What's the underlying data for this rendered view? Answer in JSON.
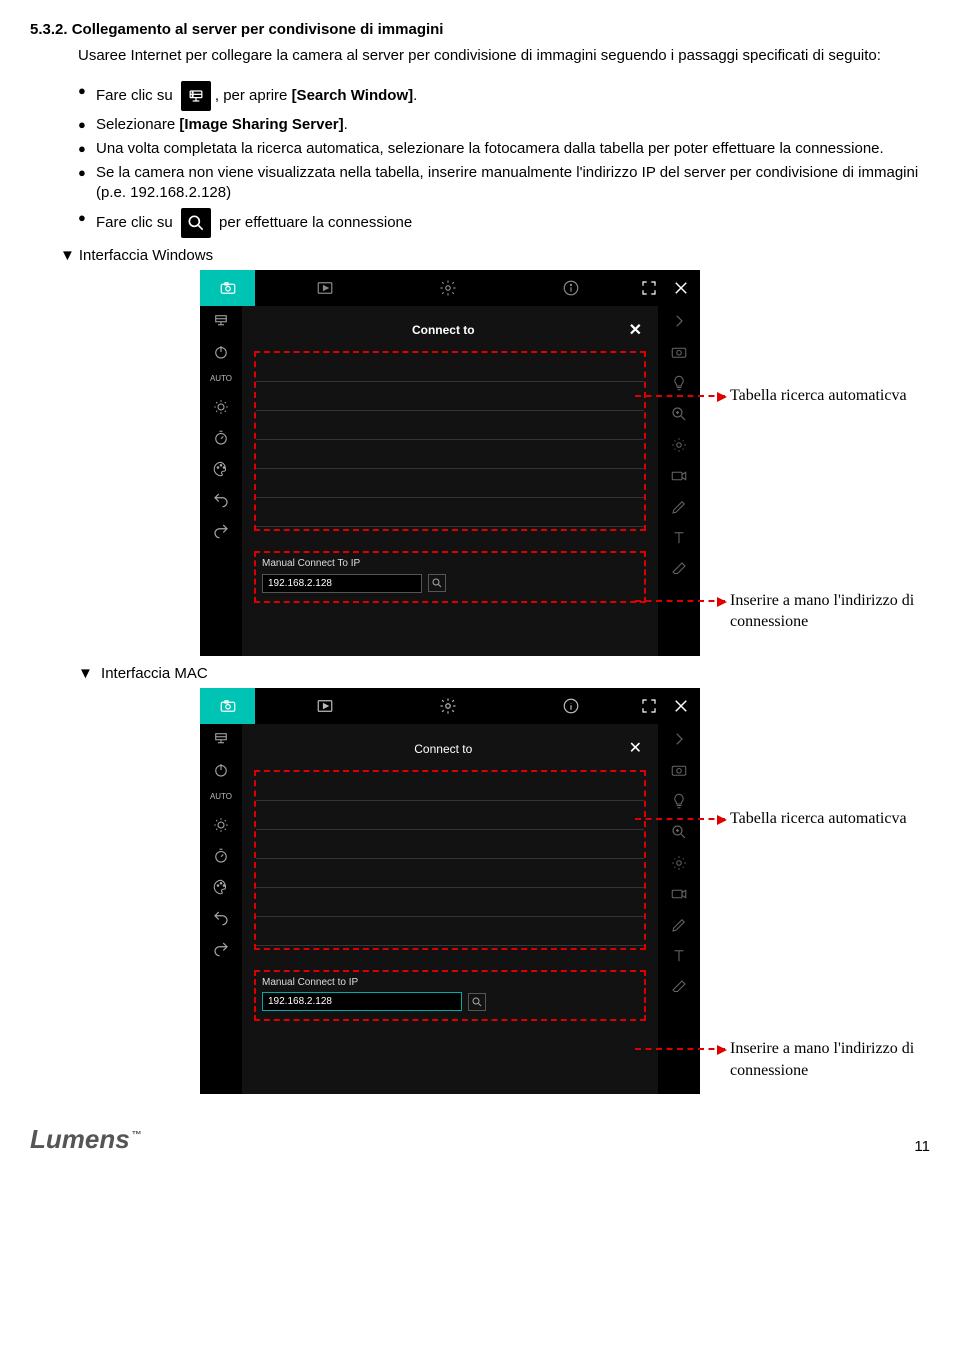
{
  "section": {
    "number": "5.3.2.",
    "title": "Collegamento al server per condivisone di immagini",
    "intro": "Usaree Internet per collegare la camera al server per condivisione di immagini seguendo i passaggi specificati di seguito:"
  },
  "bullets": {
    "b1_pre": "Fare clic su ",
    "b1_post": ", per aprire ",
    "b1_bold": "[Search Window]",
    "b1_tail": ".",
    "b2_pre": "Selezionare ",
    "b2_bold": "[Image Sharing Server]",
    "b2_tail": ".",
    "b3": "Una volta completata la ricerca automatica, selezionare la fotocamera dalla tabella per poter effettuare la connessione.",
    "b4": "Se la camera non viene visualizzata nella tabella, inserire manualmente l'indirizzo IP del server per condivisione di immagini (p.e. 192.168.2.128)",
    "b5_pre": "Fare clic su ",
    "b5_post": " per effettuare la connessione"
  },
  "labels": {
    "interfaccia_windows": "Interfaccia Windows",
    "interfaccia_mac": "Interfaccia MAC",
    "connect_to": "Connect to",
    "manual_connect": "Manual Connect To IP",
    "manual_connect_mac": "Manual Connect to IP",
    "ip_value": "192.168.2.128",
    "auto": "AUTO"
  },
  "callouts": {
    "auto_table": "Tabella ricerca automaticva",
    "manual_ip": "Inserire a mano l'indirizzo di connessione"
  },
  "footer": {
    "brand": "Lumens",
    "tm": "™",
    "page": "11"
  }
}
